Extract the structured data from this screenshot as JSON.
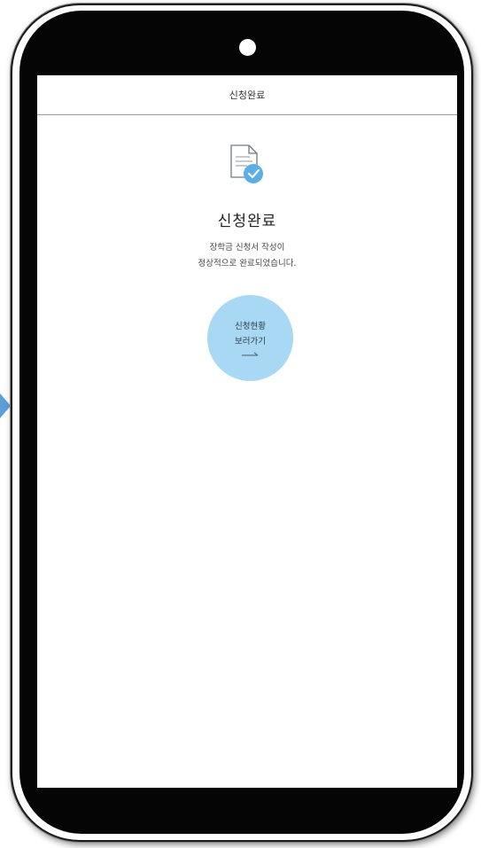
{
  "header": {
    "title": "신청완료"
  },
  "content": {
    "icon": "document-check-icon",
    "title": "신청완료",
    "description_line1": "장학금 신청서 작성이",
    "description_line2": "정상적으로 완료되었습니다."
  },
  "status_button": {
    "label_line1": "신청현황",
    "label_line2": "보러가기",
    "icon": "right-arrow-icon"
  },
  "colors": {
    "accent": "#5aaeea",
    "button_bg": "#a9d8f5",
    "frame": "#050505"
  }
}
